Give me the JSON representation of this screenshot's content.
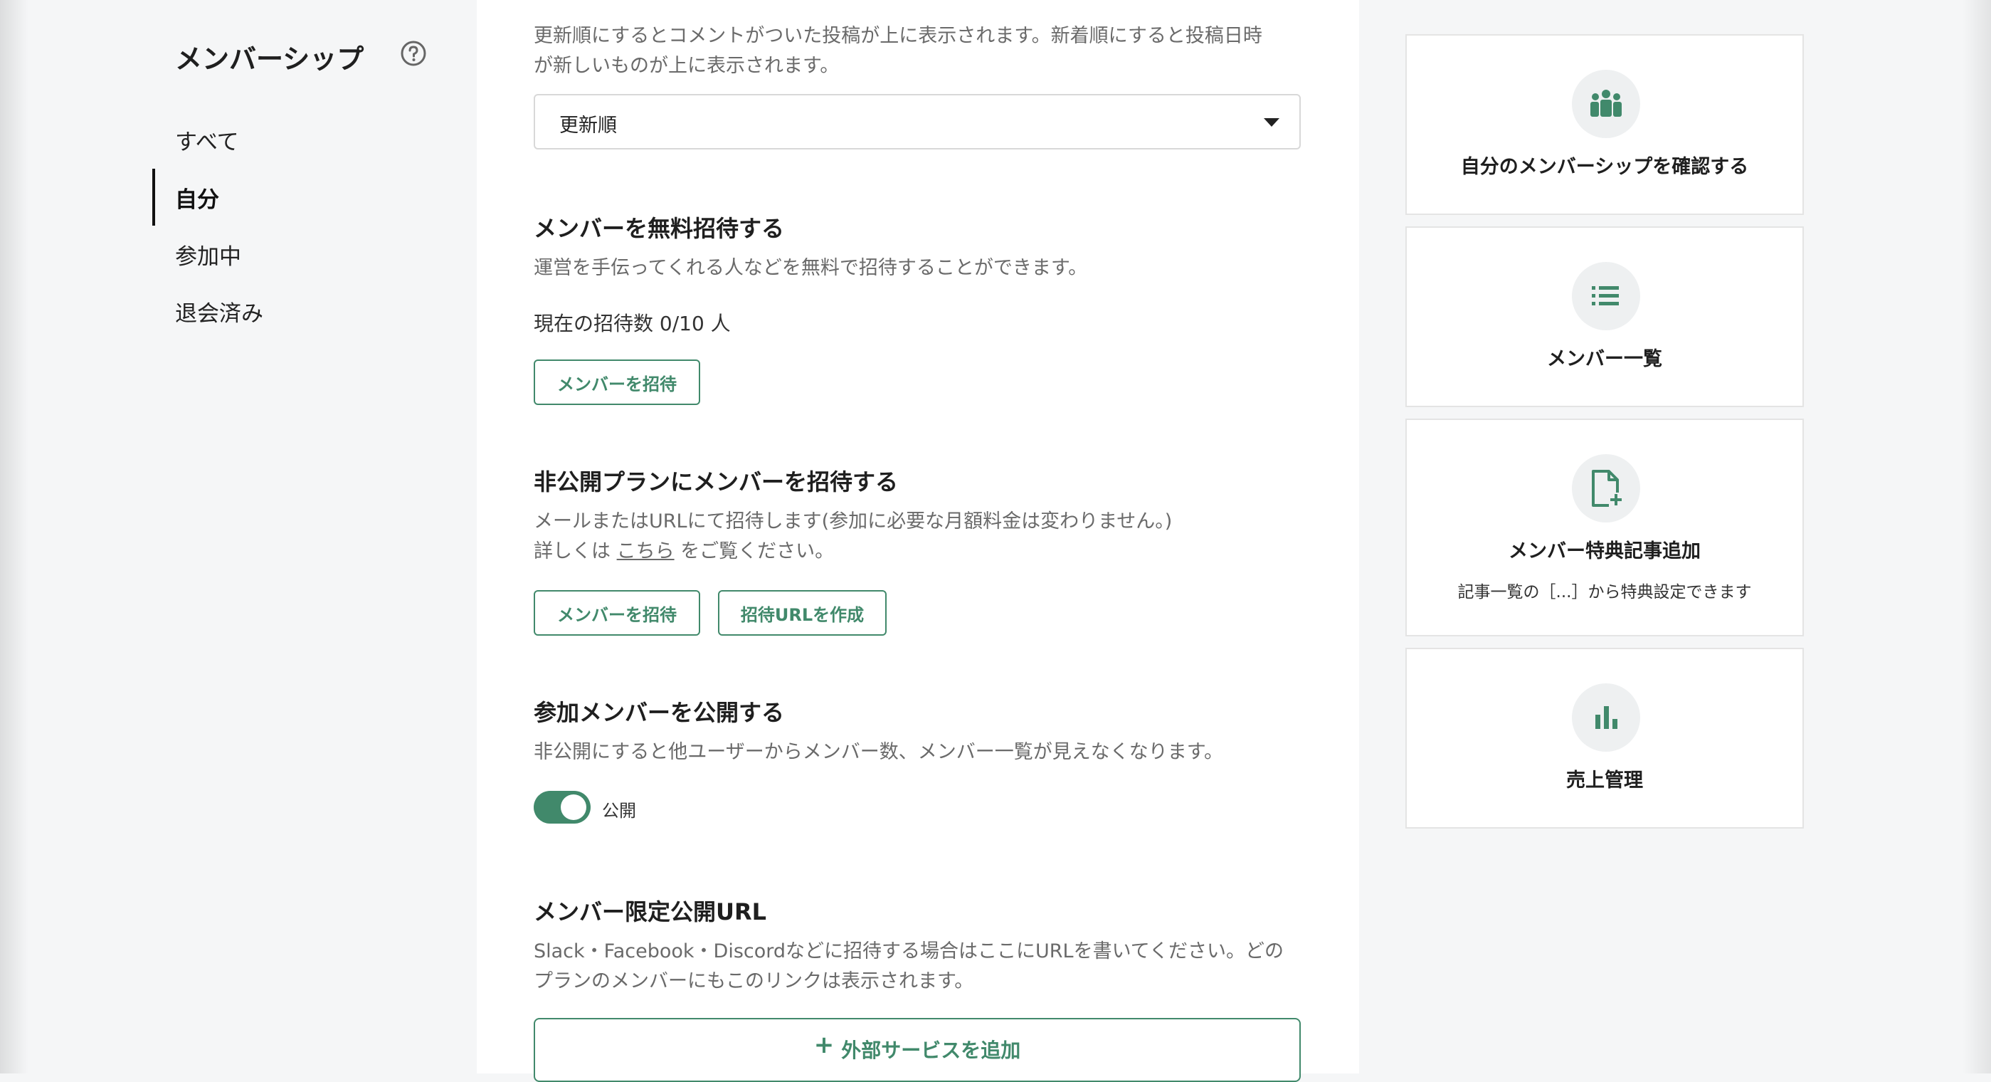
{
  "sidebar": {
    "title": "メンバーシップ",
    "help_icon": "question-circle-icon",
    "items": [
      {
        "label": "すべて",
        "active": false
      },
      {
        "label": "自分",
        "active": true
      },
      {
        "label": "参加中",
        "active": false
      },
      {
        "label": "退会済み",
        "active": false
      }
    ]
  },
  "main": {
    "board_order": {
      "desc_line1": "更新順にするとコメントがついた投稿が上に表示されます。新着順にすると投稿日時",
      "desc_line2": "が新しいものが上に表示されます。",
      "select_value": "更新順"
    },
    "free_invite": {
      "heading": "メンバーを無料招待する",
      "desc": "運営を手伝ってくれる人などを無料で招待することができます。",
      "count_text": "現在の招待数 0/10 人",
      "button": "メンバーを招待"
    },
    "private_invite": {
      "heading": "非公開プランにメンバーを招待する",
      "desc_line1": "メールまたはURLにて招待します(参加に必要な月額料金は変わりません。)",
      "desc_line2_prefix": "詳しくは",
      "desc_line2_link": "こちら",
      "desc_line2_suffix": "をご覧ください。",
      "invite_button": "メンバーを招待",
      "url_button": "招待URLを作成"
    },
    "public_members": {
      "heading": "参加メンバーを公開する",
      "desc": "非公開にすると他ユーザーからメンバー数、メンバー一覧が見えなくなります。",
      "toggle_label": "公開",
      "toggle_on": true
    },
    "member_url": {
      "heading": "メンバー限定公開URL",
      "desc_line1": "Slack・Facebook・Discordなどに招待する場合はここにURLを書いてください。どの",
      "desc_line2": "プランのメンバーにもこのリンクは表示されます。",
      "add_button": "外部サービスを追加"
    }
  },
  "cards": [
    {
      "icon": "members-group-icon",
      "title": "自分のメンバーシップを確認する"
    },
    {
      "icon": "list-icon",
      "title": "メンバー一覧"
    },
    {
      "icon": "document-add-icon",
      "title": "メンバー特典記事追加",
      "subtitle": "記事一覧の［...］から特典設定できます"
    },
    {
      "icon": "bar-chart-icon",
      "title": "売上管理"
    }
  ],
  "colors": {
    "accent": "#41896b",
    "background": "#f5f6f7"
  }
}
